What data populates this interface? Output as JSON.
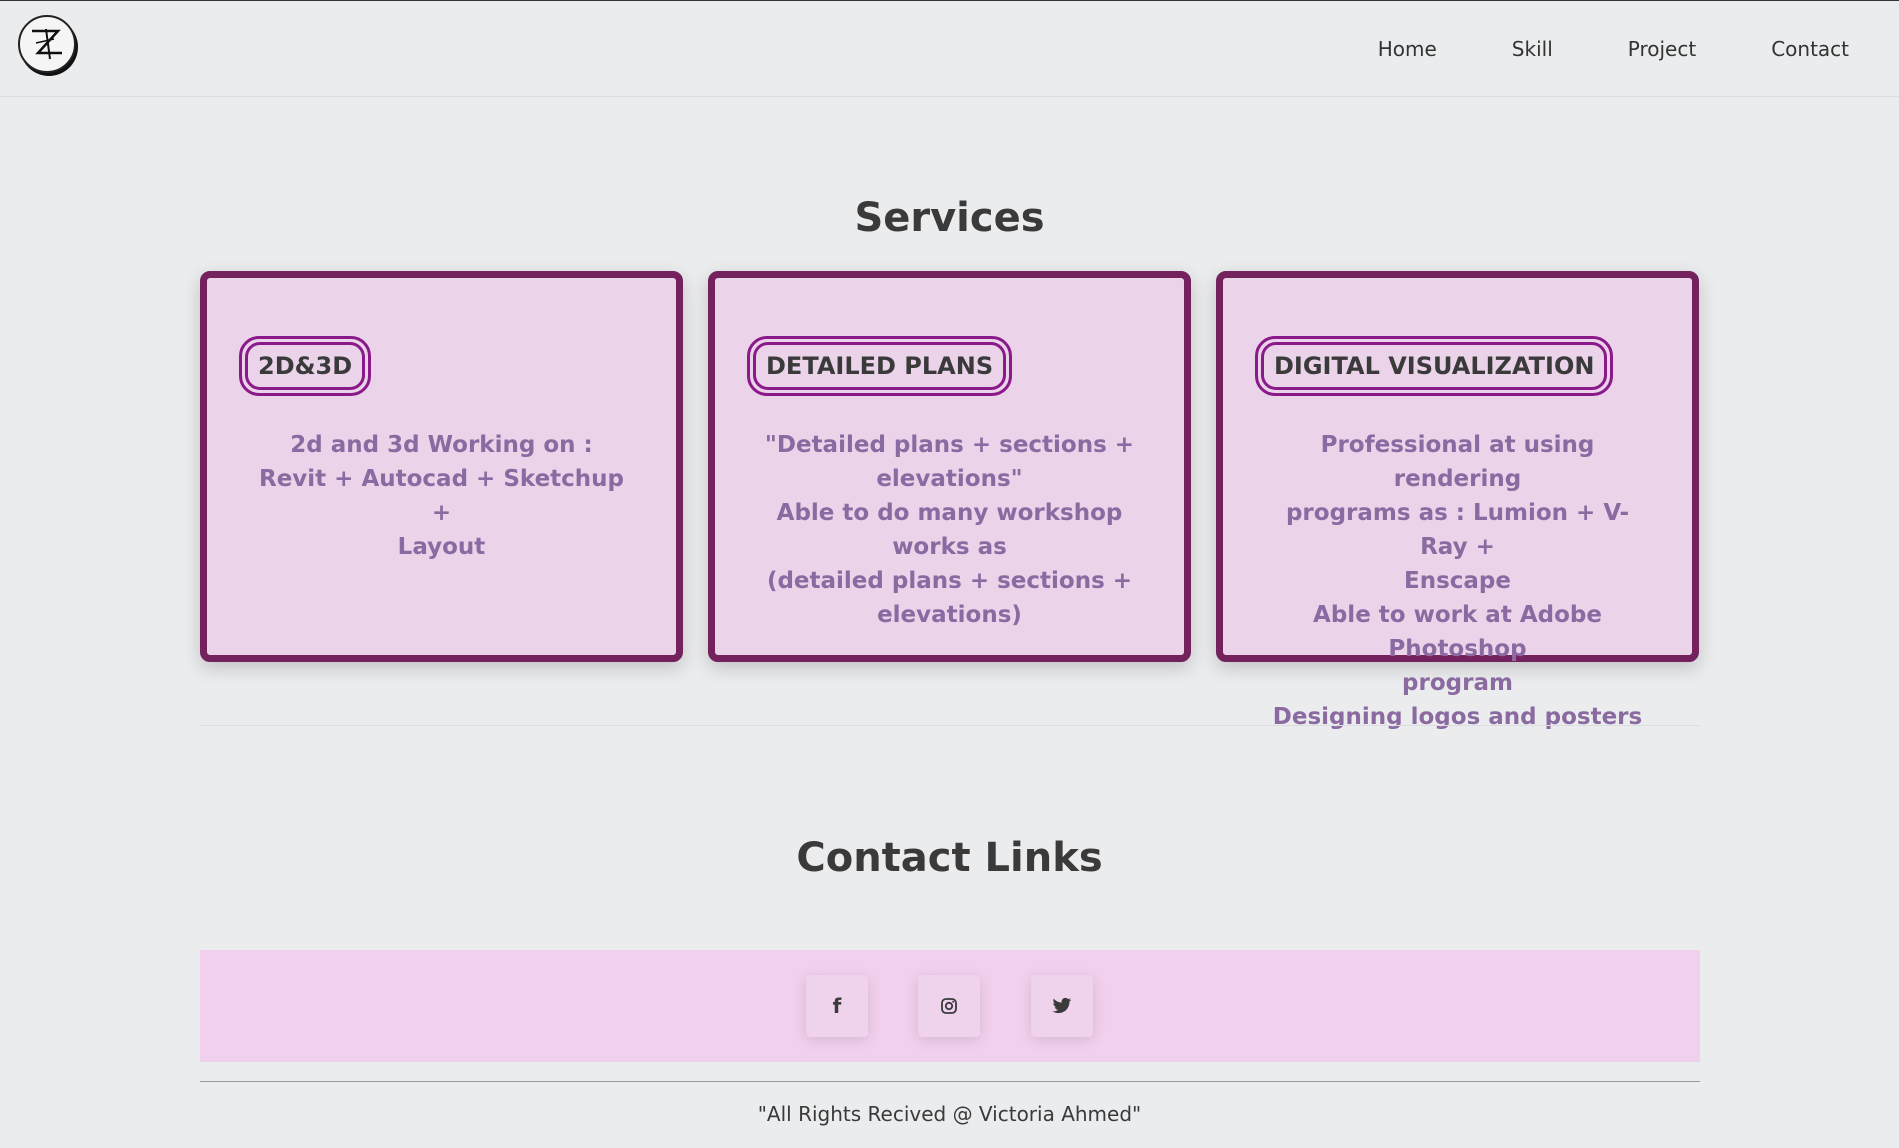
{
  "nav": {
    "items": [
      "Home",
      "Skill",
      "Project",
      "Contact"
    ]
  },
  "services": {
    "title": "Services",
    "cards": [
      {
        "badge": "2D&3D",
        "lines": [
          "2d and 3d Working on :",
          "Revit + Autocad + Sketchup +",
          "Layout"
        ]
      },
      {
        "badge": "DETAILED PLANS",
        "lines": [
          "\"Detailed plans + sections +",
          "elevations\"",
          "Able to do many workshop works as",
          "(detailed plans + sections +",
          "elevations)"
        ]
      },
      {
        "badge": "DIGITAL VISUALIZATION",
        "lines": [
          "Professional at using rendering",
          "programs as : Lumion + V-Ray +",
          "Enscape",
          "Able to work at Adobe Photoshop",
          "program",
          "Designing logos and posters"
        ]
      }
    ]
  },
  "contact": {
    "title": "Contact Links",
    "social": [
      {
        "name": "facebook-icon",
        "glyph": "f"
      },
      {
        "name": "instagram-icon",
        "glyph": ""
      },
      {
        "name": "twitter-icon",
        "glyph": ""
      }
    ]
  },
  "footer": {
    "text": "\"All Rights Recived @ Victoria Ahmed\""
  },
  "colors": {
    "card_border": "#74225d",
    "card_bg": "#ebd3ea",
    "badge_border": "#8a1a8a",
    "card_text": "#8a6aa0",
    "social_bar": "#f1d0ee"
  }
}
